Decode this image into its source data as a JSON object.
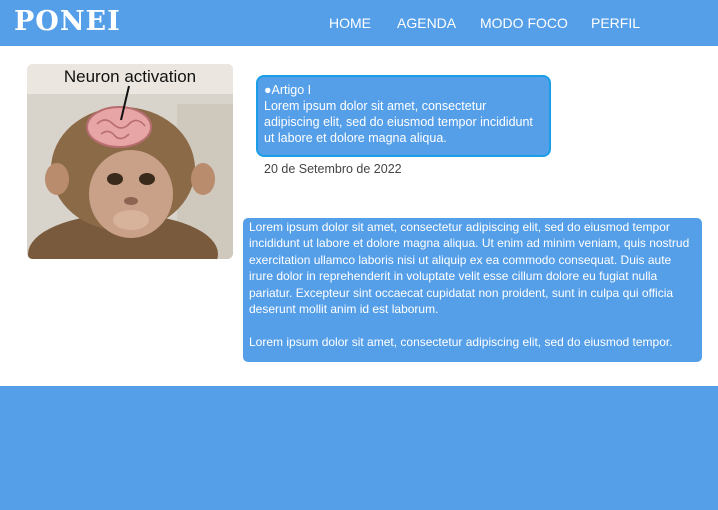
{
  "header": {
    "logo": "PONEI",
    "nav": [
      {
        "label": "HOME"
      },
      {
        "label": "AGENDA"
      },
      {
        "label": "MODO FOCO"
      },
      {
        "label": "PERFIL"
      }
    ]
  },
  "post": {
    "image_caption": "Neuron activation",
    "card_title": "●Artigo I",
    "card_text": "Lorem ipsum dolor sit amet, consectetur adipiscing elit, sed do eiusmod tempor incididunt ut labore et dolore magna aliqua.",
    "date": "20 de Setembro de 2022",
    "body_paragraph_1": "Lorem ipsum dolor sit amet, consectetur adipiscing elit, sed do eiusmod tempor incididunt ut labore et dolore magna aliqua. Ut enim ad minim veniam, quis nostrud exercitation ullamco laboris nisi ut aliquip ex ea commodo consequat. Duis aute irure dolor in reprehenderit in voluptate velit esse cillum dolore eu fugiat nulla pariatur. Excepteur sint occaecat cupidatat non proident, sunt in culpa qui officia deserunt mollit anim id est laborum.",
    "body_paragraph_2": "Lorem ipsum dolor sit amet, consectetur adipiscing elit, sed do eiusmod tempor."
  },
  "colors": {
    "primary": "#559fe9",
    "card_border": "#1a9ee8",
    "background": "#ffffff"
  }
}
